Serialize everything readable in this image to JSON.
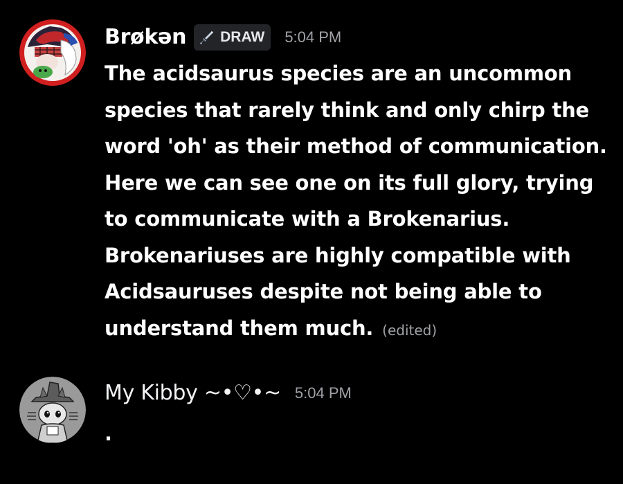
{
  "messages": [
    {
      "author": "Brøkən",
      "tag": {
        "icon": "sword-icon",
        "label": "DRAW"
      },
      "timestamp": "5:04 PM",
      "text": "The acidsaurus species are an uncommon species that rarely think and only chirp the word 'oh' as their method of communication. Here we can see one on its full glory, trying to communicate with a Brokenarius. Brokenariuses are highly compatible with Acidsauruses despite not being able to understand them much.",
      "edited_label": "(edited)",
      "avatar": "red-ring-character-avatar"
    },
    {
      "author": "My Kibby ~•♡•~",
      "timestamp": "5:04 PM",
      "text": ".",
      "avatar": "gray-witch-hat-character-avatar"
    }
  ],
  "colors": {
    "background": "#000000",
    "text": "#ffffff",
    "timestamp": "#a0a2a7",
    "tag_background": "#232428",
    "avatar1_ring": "#d11f1f"
  }
}
